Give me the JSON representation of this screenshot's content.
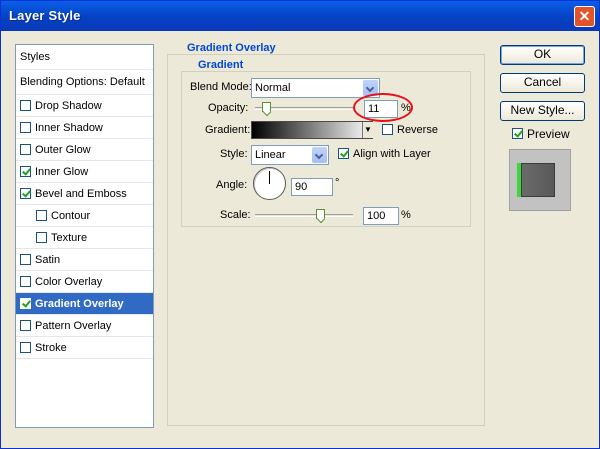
{
  "window": {
    "title": "Layer Style",
    "close_label": "✕"
  },
  "left_panel": {
    "styles_header": "Styles",
    "blending_header": "Blending Options: Default",
    "items": [
      {
        "label": "Drop Shadow",
        "checked": false
      },
      {
        "label": "Inner Shadow",
        "checked": false
      },
      {
        "label": "Outer Glow",
        "checked": false
      },
      {
        "label": "Inner Glow",
        "checked": true
      },
      {
        "label": "Bevel and Emboss",
        "checked": true
      },
      {
        "label": "Contour",
        "checked": false
      },
      {
        "label": "Texture",
        "checked": false
      },
      {
        "label": "Satin",
        "checked": false
      },
      {
        "label": "Color Overlay",
        "checked": false
      },
      {
        "label": "Gradient Overlay",
        "checked": true
      },
      {
        "label": "Pattern Overlay",
        "checked": false
      },
      {
        "label": "Stroke",
        "checked": false
      }
    ]
  },
  "gradient_overlay": {
    "group_title": "Gradient Overlay",
    "subgroup_title": "Gradient",
    "blend_mode_label": "Blend Mode:",
    "blend_mode_value": "Normal",
    "opacity_label": "Opacity:",
    "opacity_value": "11",
    "opacity_unit": "%",
    "opacity_level": 0.11,
    "gradient_label": "Gradient:",
    "reverse_label": "Reverse",
    "reverse_checked": false,
    "style_label": "Style:",
    "style_value": "Linear",
    "align_label": "Align with Layer",
    "align_checked": true,
    "angle_label": "Angle:",
    "angle_value": "90",
    "angle_unit": "°",
    "scale_label": "Scale:",
    "scale_value": "100",
    "scale_unit": "%",
    "scale_level": 100
  },
  "buttons": {
    "ok": "OK",
    "cancel": "Cancel",
    "new_style": "New Style...",
    "preview_label": "Preview",
    "preview_checked": true
  },
  "colors": {
    "title_bar": "#0a5fe6",
    "selection": "#316ac5",
    "highlight_circle": "#e8101a",
    "preview_accent": "#3ed63e"
  }
}
